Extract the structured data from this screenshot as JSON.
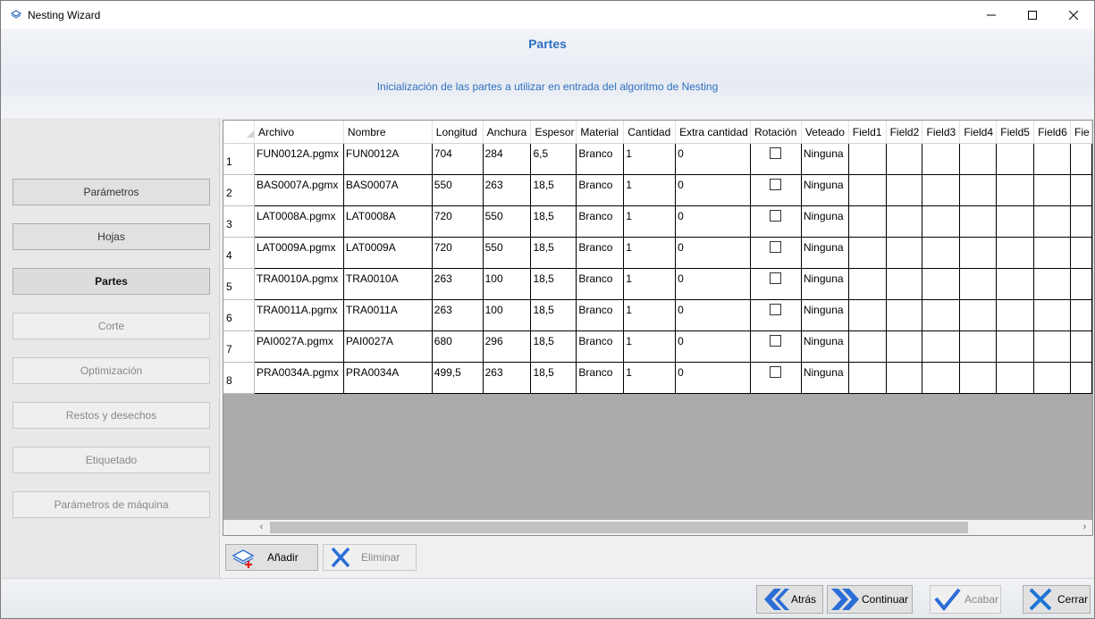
{
  "window": {
    "title": "Nesting Wizard"
  },
  "header": {
    "title": "Partes",
    "subtitle": "Inicialización de las partes a utilizar en entrada del algoritmo de Nesting"
  },
  "sidebar": {
    "items": [
      {
        "label": "Parámetros",
        "state": "enabled"
      },
      {
        "label": "Hojas",
        "state": "enabled"
      },
      {
        "label": "Partes",
        "state": "active"
      },
      {
        "label": "Corte",
        "state": "disabled"
      },
      {
        "label": "Optimización",
        "state": "disabled"
      },
      {
        "label": "Restos y desechos",
        "state": "disabled"
      },
      {
        "label": "Etiquetado",
        "state": "disabled"
      },
      {
        "label": "Parámetros de máquina",
        "state": "disabled"
      }
    ]
  },
  "grid": {
    "columns": [
      "Archivo",
      "Nombre",
      "Longitud",
      "Anchura",
      "Espesor",
      "Material",
      "Cantidad",
      "Extra cantidad",
      "Rotación",
      "Veteado",
      "Field1",
      "Field2",
      "Field3",
      "Field4",
      "Field5",
      "Field6",
      "Fie"
    ],
    "rows": [
      {
        "num": "1",
        "archivo": "FUN0012A.pgmx",
        "nombre": "FUN0012A",
        "longitud": "704",
        "anchura": "284",
        "espesor": "6,5",
        "material": "Branco",
        "cantidad": "1",
        "extra": "0",
        "rotacion": false,
        "veteado": "Ninguna"
      },
      {
        "num": "2",
        "archivo": "BAS0007A.pgmx",
        "nombre": "BAS0007A",
        "longitud": "550",
        "anchura": "263",
        "espesor": "18,5",
        "material": "Branco",
        "cantidad": "1",
        "extra": "0",
        "rotacion": false,
        "veteado": "Ninguna"
      },
      {
        "num": "3",
        "archivo": "LAT0008A.pgmx",
        "nombre": "LAT0008A",
        "longitud": "720",
        "anchura": "550",
        "espesor": "18,5",
        "material": "Branco",
        "cantidad": "1",
        "extra": "0",
        "rotacion": false,
        "veteado": "Ninguna"
      },
      {
        "num": "4",
        "archivo": "LAT0009A.pgmx",
        "nombre": "LAT0009A",
        "longitud": "720",
        "anchura": "550",
        "espesor": "18,5",
        "material": "Branco",
        "cantidad": "1",
        "extra": "0",
        "rotacion": false,
        "veteado": "Ninguna"
      },
      {
        "num": "5",
        "archivo": "TRA0010A.pgmx",
        "nombre": "TRA0010A",
        "longitud": "263",
        "anchura": "100",
        "espesor": "18,5",
        "material": "Branco",
        "cantidad": "1",
        "extra": "0",
        "rotacion": false,
        "veteado": "Ninguna"
      },
      {
        "num": "6",
        "archivo": "TRA0011A.pgmx",
        "nombre": "TRA0011A",
        "longitud": "263",
        "anchura": "100",
        "espesor": "18,5",
        "material": "Branco",
        "cantidad": "1",
        "extra": "0",
        "rotacion": false,
        "veteado": "Ninguna"
      },
      {
        "num": "7",
        "archivo": "PAI0027A.pgmx",
        "nombre": "PAI0027A",
        "longitud": "680",
        "anchura": "296",
        "espesor": "18,5",
        "material": "Branco",
        "cantidad": "1",
        "extra": "0",
        "rotacion": false,
        "veteado": "Ninguna"
      },
      {
        "num": "8",
        "archivo": "PRA0034A.pgmx",
        "nombre": "PRA0034A",
        "longitud": "499,5",
        "anchura": "263",
        "espesor": "18,5",
        "material": "Branco",
        "cantidad": "1",
        "extra": "0",
        "rotacion": false,
        "veteado": "Ninguna"
      }
    ]
  },
  "toolbar": {
    "add_label": "Añadir",
    "remove_label": "Eliminar"
  },
  "footer": {
    "back_label": "Atrás",
    "continue_label": "Continuar",
    "finish_label": "Acabar",
    "close_label": "Cerrar"
  },
  "colors": {
    "accent": "#2e6fc1",
    "nav_blue": "#2a6dd6",
    "close_x": "#1e74d6",
    "add_plus": "#e02020"
  }
}
